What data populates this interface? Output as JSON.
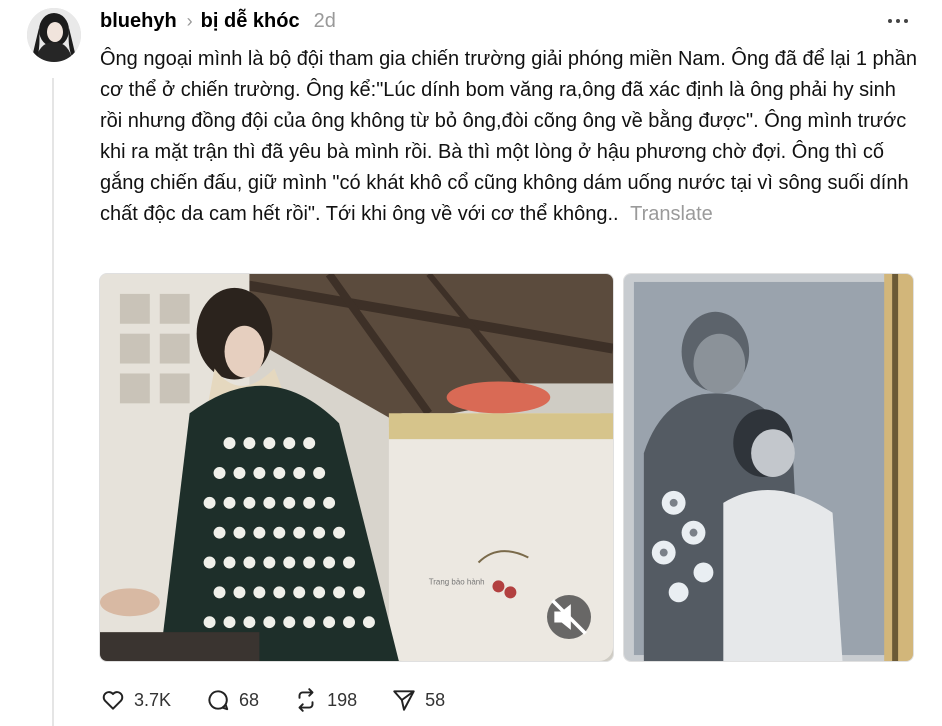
{
  "post": {
    "username": "bluehyh",
    "topic": "bị dễ khóc",
    "time": "2d",
    "text": "Ông ngoại mình là bộ đội tham gia chiến trường giải phóng miền Nam. Ông đã để lại 1 phần cơ thể ở chiến trường. Ông kể:\"Lúc dính bom văng ra,ông đã xác định là ông phải hy sinh rồi nhưng đồng đội của ông không từ bỏ ông,đòi cõng ông về bằng được\". Ông mình trước khi ra mặt trận thì đã yêu bà mình rồi. Bà thì một lòng ở hậu phương chờ đợi. Ông thì cố gắng chiến đấu, giữ mình \"có khát khô cổ cũng không dám uống nước tại vì sông suối dính chất độc da cam hết rồi\". Tới khi ông về với cơ thể không..",
    "translate_label": "Translate"
  },
  "media": {
    "video_label": "Trang bảo hành",
    "mute_icon": "speaker-muted-icon"
  },
  "actions": {
    "likes": "3.7K",
    "comments": "68",
    "reposts": "198",
    "shares": "58"
  },
  "colors": {
    "muted_text": "#999999",
    "thread_line": "#e5e5e5"
  }
}
